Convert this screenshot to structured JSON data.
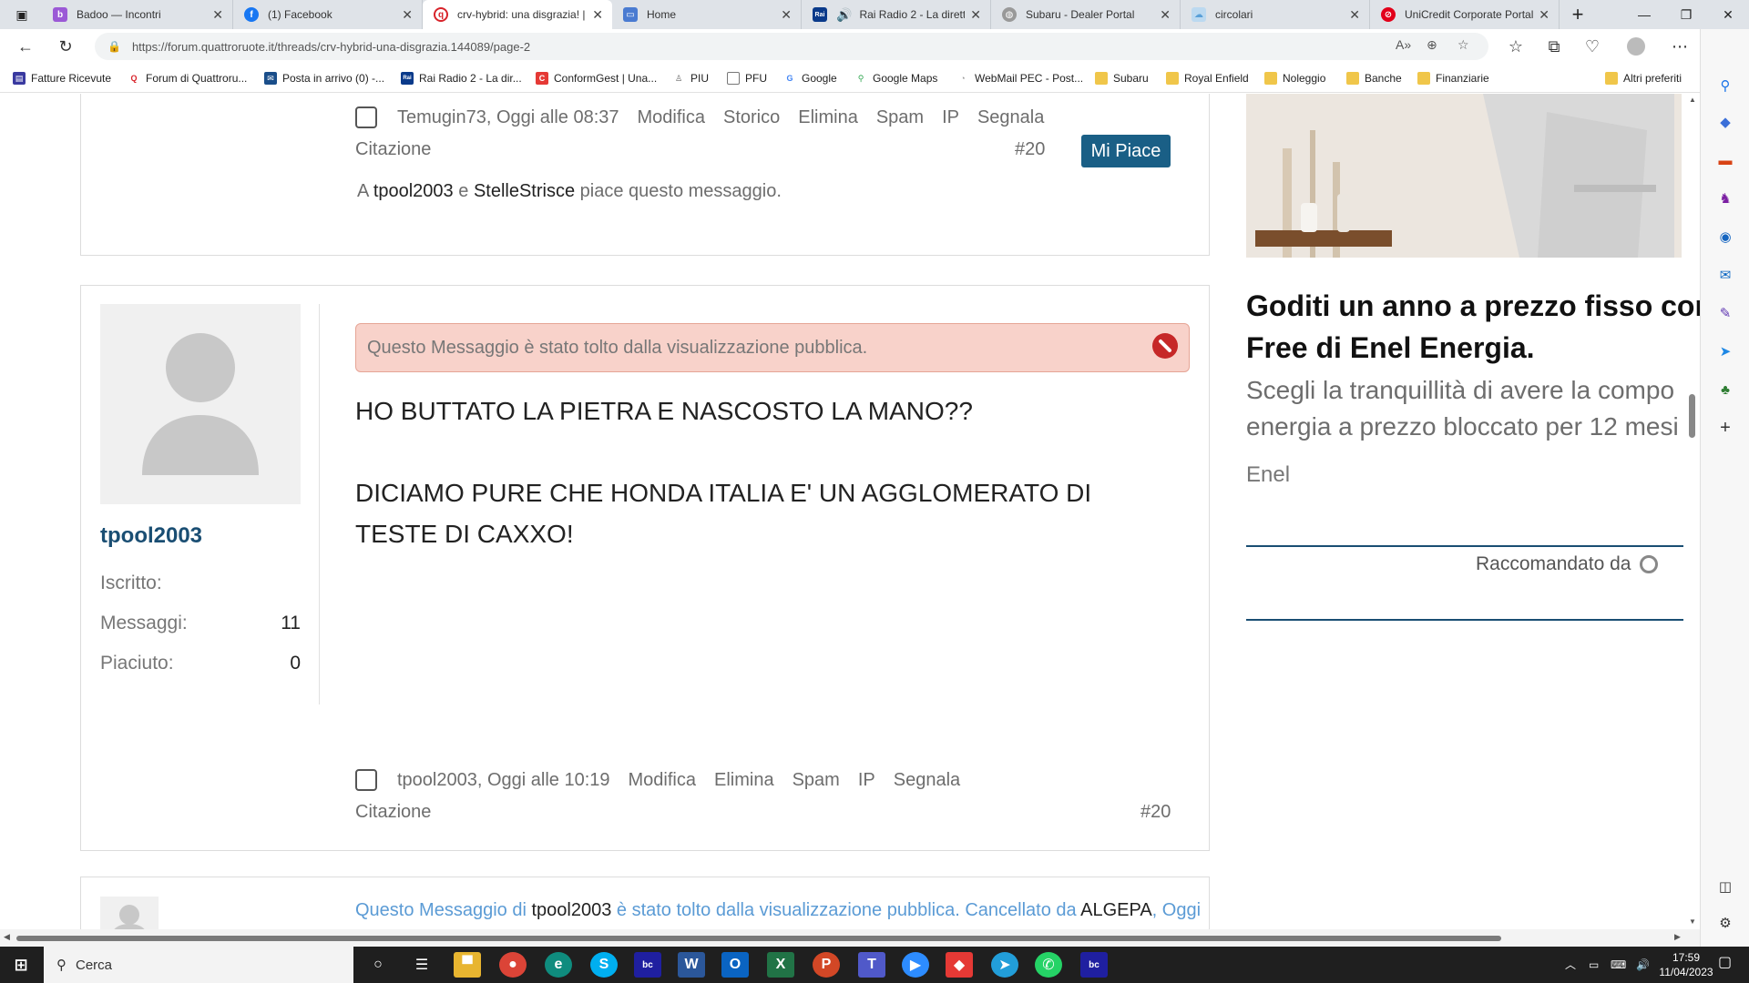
{
  "tabs": [
    {
      "label": "Badoo — Incontri",
      "icon": "badoo-icon",
      "color": "#9b59d6"
    },
    {
      "label": "(1) Facebook",
      "icon": "facebook-icon",
      "color": "#1877f2"
    },
    {
      "label": "crv-hybrid: una disgrazia! |",
      "icon": "quattroruote-icon",
      "color": "#d8232a"
    },
    {
      "label": "Home",
      "icon": "home-page-icon",
      "color": "#4a7bd1"
    },
    {
      "label": "Rai Radio 2 - La dirett",
      "icon": "rai-icon",
      "color": "#0a3a8a"
    },
    {
      "label": "Subaru - Dealer Portal",
      "icon": "globe-icon",
      "color": "#777777"
    },
    {
      "label": "circolari",
      "icon": "cloud-icon",
      "color": "#5aa0d8"
    },
    {
      "label": "UniCredit Corporate Portal",
      "icon": "unicredit-icon",
      "color": "#e2001a"
    }
  ],
  "address": {
    "url": "https://forum.quattroruote.it/threads/crv-hybrid-una-disgrazia.144089/page-2"
  },
  "bookmarks": [
    {
      "label": "Fatture Ricevute",
      "icon": "fatture-icon"
    },
    {
      "label": "Forum di Quattroru...",
      "icon": "quattroruote-icon"
    },
    {
      "label": "Posta in arrivo (0) -...",
      "icon": "mail-icon"
    },
    {
      "label": "Rai Radio 2 - La dir...",
      "icon": "rai-icon"
    },
    {
      "label": "ConformGest | Una...",
      "icon": "conformgest-icon"
    },
    {
      "label": "PIU",
      "icon": "piu-icon"
    },
    {
      "label": "PFU",
      "icon": "page-icon"
    },
    {
      "label": "Google",
      "icon": "google-icon"
    },
    {
      "label": "Google Maps",
      "icon": "maps-icon"
    },
    {
      "label": "WebMail PEC - Post...",
      "icon": "webmail-icon"
    },
    {
      "label": "Subaru",
      "icon": "folder-icon"
    },
    {
      "label": "Royal Enfield",
      "icon": "folder-icon"
    },
    {
      "label": "Noleggio",
      "icon": "folder-icon"
    },
    {
      "label": "Banche",
      "icon": "folder-icon"
    },
    {
      "label": "Finanziarie",
      "icon": "folder-icon"
    },
    {
      "label": "Altri preferiti",
      "icon": "folder-icon"
    }
  ],
  "post1": {
    "author_time": "Temugin73, Oggi alle 08:37",
    "actions": [
      "Modifica",
      "Storico",
      "Elimina",
      "Spam",
      "IP",
      "Segnala"
    ],
    "citazione": "Citazione",
    "number": "#20",
    "like_button": "Mi Piace",
    "likes_prefix": "A",
    "liker1": "tpool2003",
    "likes_and": "e",
    "liker2": "StelleStrisce",
    "likes_suffix": "piace questo messaggio."
  },
  "post2": {
    "username": "tpool2003",
    "stats": [
      {
        "label": "Iscritto:",
        "value": ""
      },
      {
        "label": "Messaggi:",
        "value": "11"
      },
      {
        "label": "Piaciuto:",
        "value": "0"
      }
    ],
    "removed_notice": "Questo Messaggio è stato tolto dalla visualizzazione pubblica.",
    "message_line1": "HO BUTTATO LA PIETRA E NASCOSTO LA MANO??",
    "message_line2": "DICIAMO PURE CHE HONDA ITALIA E' UN AGGLOMERATO DI TESTE DI CAXXO!",
    "author_time": "tpool2003, Oggi alle 10:19",
    "actions": [
      "Modifica",
      "Elimina",
      "Spam",
      "IP",
      "Segnala"
    ],
    "citazione": "Citazione",
    "number": "#20"
  },
  "post3": {
    "prefix": "Questo Messaggio di",
    "user": "tpool2003",
    "middle": "è stato tolto dalla visualizzazione pubblica. Cancellato da",
    "moderator": "ALGEPA",
    "suffix": ", Oggi"
  },
  "ad": {
    "title_line1": "Goditi un anno a prezzo fisso con",
    "title_line2": "Free di Enel Energia.",
    "sub_line1": "Scegli la tranquillità di avere la compo",
    "sub_line2": "energia a prezzo bloccato per 12 mesi",
    "brand": "Enel",
    "recommended": "Raccomandato da"
  },
  "taskbar": {
    "search_placeholder": "Cerca",
    "time": "17:59",
    "date": "11/04/2023"
  },
  "colors": {
    "accent": "#1a5f86",
    "username": "#1a4e73",
    "removed_bg": "#f8d2ca",
    "link_blue": "#5b9bd5"
  }
}
